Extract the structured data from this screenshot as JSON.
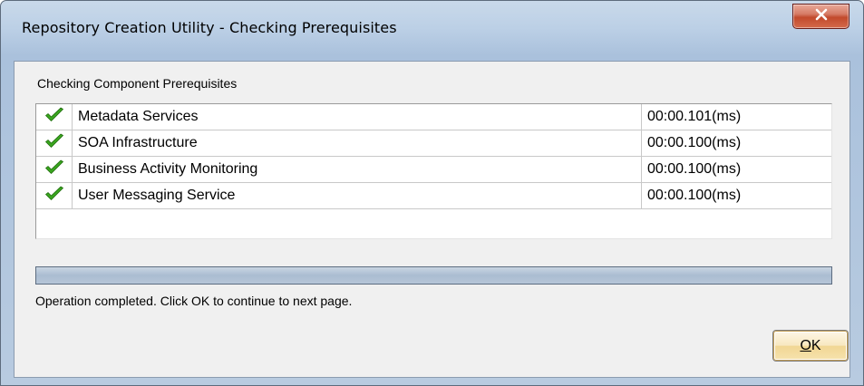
{
  "window": {
    "title": "Repository Creation Utility - Checking Prerequisites",
    "close_icon": "close-x-icon"
  },
  "main": {
    "section_label": "Checking Component Prerequisites",
    "components": [
      {
        "status_icon": "green-checkmark-icon",
        "name": "Metadata Services",
        "time": "00:00.101(ms)"
      },
      {
        "status_icon": "green-checkmark-icon",
        "name": "SOA Infrastructure",
        "time": "00:00.100(ms)"
      },
      {
        "status_icon": "green-checkmark-icon",
        "name": "Business Activity Monitoring",
        "time": "00:00.100(ms)"
      },
      {
        "status_icon": "green-checkmark-icon",
        "name": "User Messaging Service",
        "time": "00:00.100(ms)"
      }
    ],
    "progress_fraction": 1.0,
    "status_message": "Operation completed. Click OK to continue to next page."
  },
  "footer": {
    "ok_mnemonic": "O",
    "ok_rest": "K"
  },
  "colors": {
    "check_green": "#3aa51f",
    "close_red": "#c24a2c",
    "ok_button_bg": "#f8e7bf"
  }
}
